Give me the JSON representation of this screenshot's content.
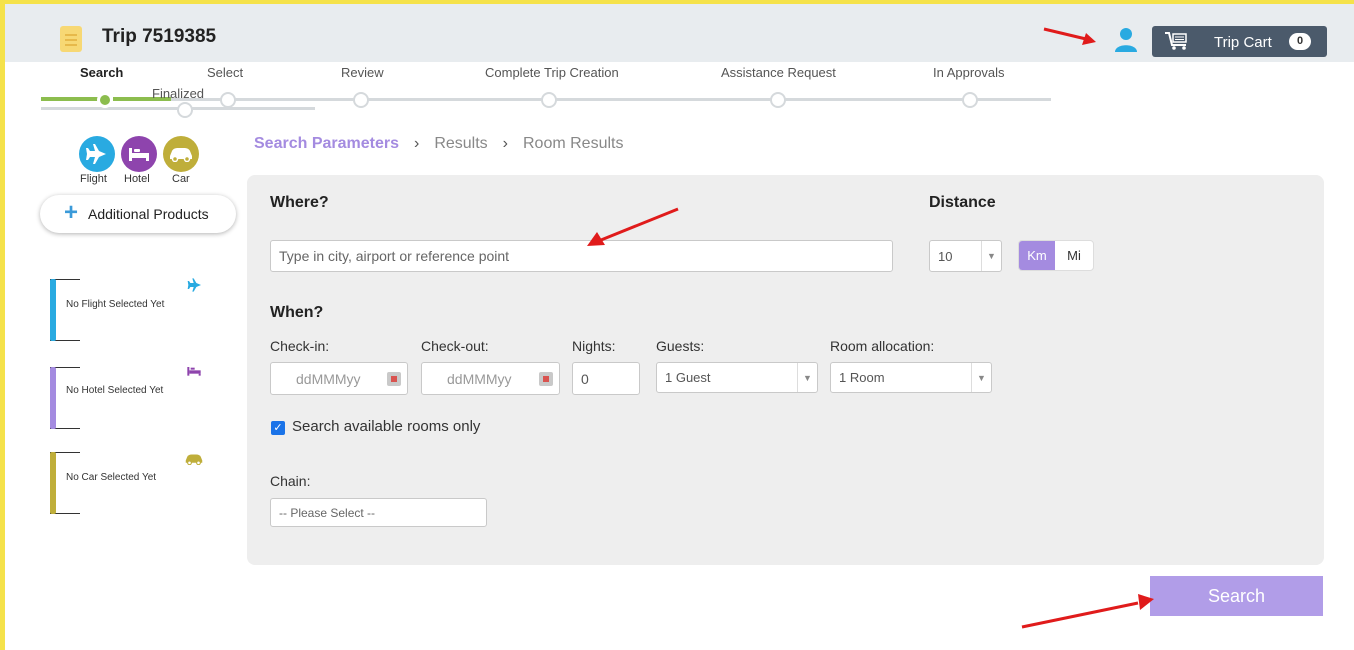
{
  "header": {
    "trip_title": "Trip 7519385",
    "cart_label": "Trip Cart",
    "cart_count": "0"
  },
  "stepper": {
    "steps": [
      {
        "label": "Search"
      },
      {
        "label": "Select"
      },
      {
        "label": "Review"
      },
      {
        "label": "Complete Trip Creation"
      },
      {
        "label": "Assistance Request"
      },
      {
        "label": "In Approvals"
      },
      {
        "label": "Finalized"
      }
    ],
    "current": "Search"
  },
  "products": {
    "flight_label": "Flight",
    "hotel_label": "Hotel",
    "car_label": "Car",
    "additional_label": "Additional Products"
  },
  "selections": {
    "flight": "No Flight Selected Yet",
    "hotel": "No Hotel Selected Yet",
    "car": "No Car Selected Yet"
  },
  "breadcrumb": {
    "items": [
      "Search Parameters",
      "Results",
      "Room Results"
    ],
    "separator": "›"
  },
  "form": {
    "where_label": "Where?",
    "where_placeholder": "Type in city, airport or reference point",
    "distance_label": "Distance",
    "distance_value": "10",
    "unit_km": "Km",
    "unit_mi": "Mi",
    "when_label": "When?",
    "checkin_label": "Check-in:",
    "checkin_placeholder": "ddMMMyy",
    "checkout_label": "Check-out:",
    "checkout_placeholder": "ddMMMyy",
    "nights_label": "Nights:",
    "nights_value": "0",
    "guests_label": "Guests:",
    "guests_value": "1 Guest",
    "rooms_label": "Room allocation:",
    "rooms_value": "1 Room",
    "available_only_label": "Search available rooms only",
    "chain_label": "Chain:",
    "chain_placeholder": "-- Please Select --",
    "search_button": "Search"
  },
  "colors": {
    "accent": "#a48be0",
    "progress": "#8cbd4e",
    "flight": "#29aae1",
    "hotel": "#8e44ad",
    "car": "#bfae3a",
    "annotation_arrow": "#e01b1b"
  }
}
